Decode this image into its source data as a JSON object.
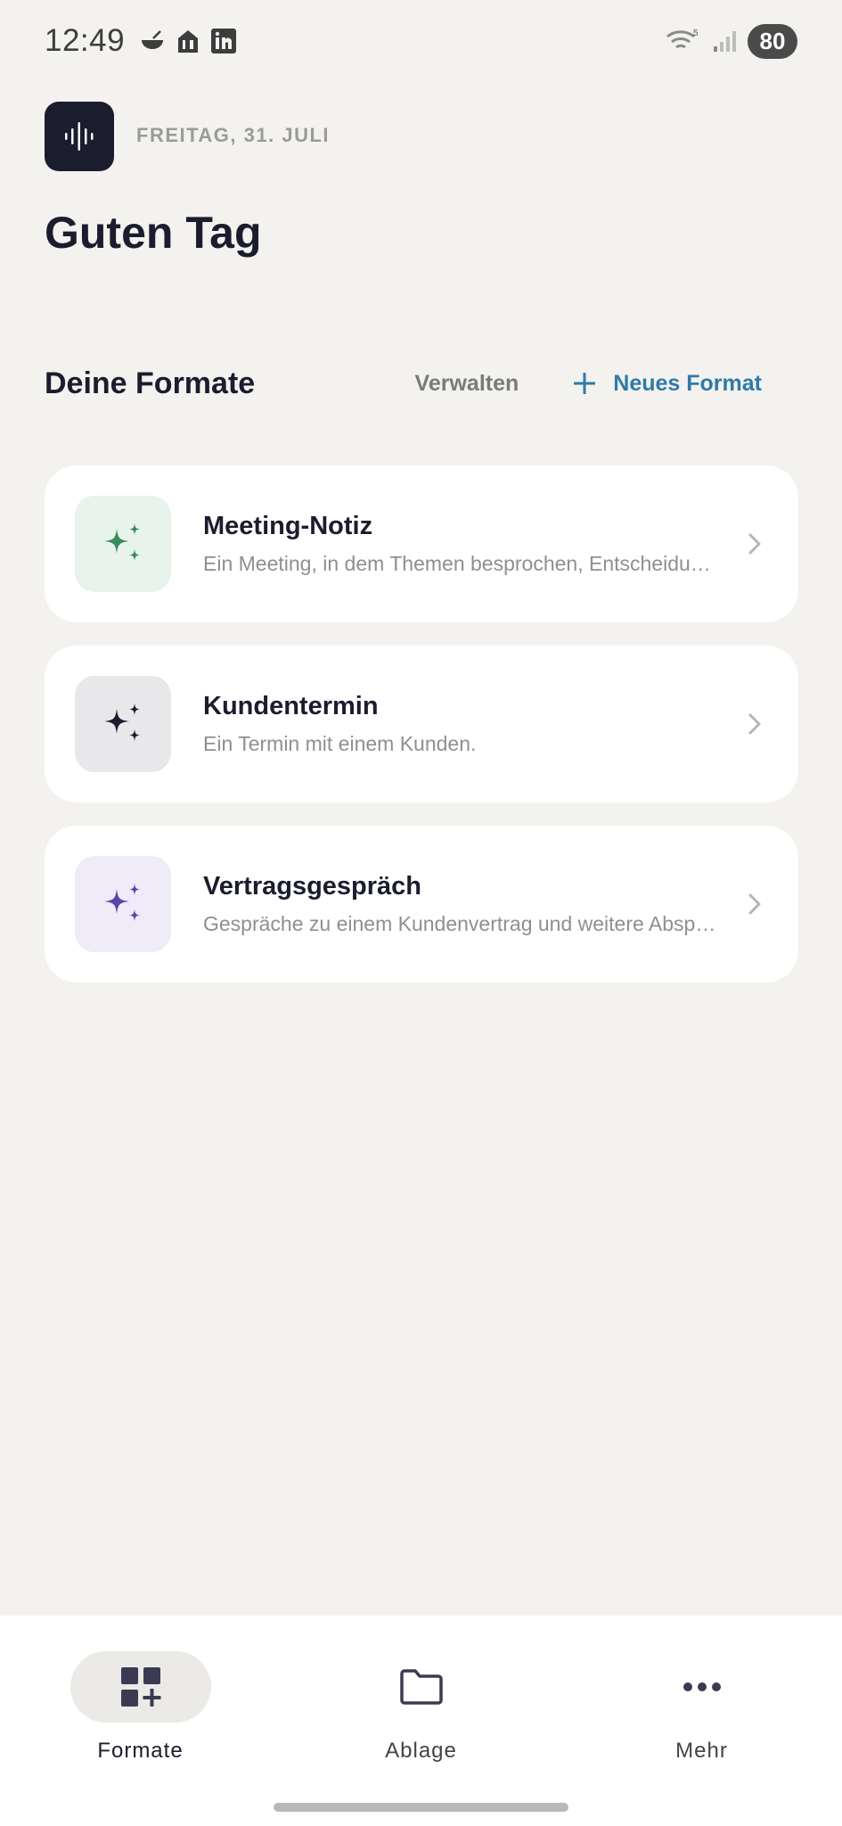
{
  "status_bar": {
    "time": "12:49",
    "battery": "80",
    "left_icons": [
      "bowl-icon",
      "food-delivery-icon",
      "linkedin-icon"
    ],
    "right_icons": [
      "wifi-icon",
      "signal-icon"
    ]
  },
  "header": {
    "date": "FREITAG, 31. JULI",
    "greeting": "Guten Tag",
    "logo_icon": "waveform-icon"
  },
  "formats_section": {
    "title": "Deine Formate",
    "manage_label": "Verwalten",
    "new_format_label": "Neues Format"
  },
  "formats": [
    {
      "title": "Meeting-Notiz",
      "description": "Ein Meeting, in dem Themen besprochen, Entscheidungen getroffen werden",
      "icon": "sparkles-icon",
      "icon_color": "#3a8a5c",
      "icon_bg": "#e8f3ec"
    },
    {
      "title": "Kundentermin",
      "description": "Ein Termin mit einem Kunden.",
      "icon": "sparkles-icon",
      "icon_color": "#1b1c2e",
      "icon_bg": "#e8e8ea"
    },
    {
      "title": "Vertragsgespräch",
      "description": "Gespräche zu einem Kundenvertrag und weitere Absprachen",
      "icon": "sparkles-icon",
      "icon_color": "#5b45a8",
      "icon_bg": "#efebf8"
    }
  ],
  "bottom_nav": {
    "items": [
      {
        "label": "Formate",
        "icon": "grid-add-icon",
        "active": true
      },
      {
        "label": "Ablage",
        "icon": "folder-icon",
        "active": false
      },
      {
        "label": "Mehr",
        "icon": "more-dots-icon",
        "active": false
      }
    ]
  },
  "colors": {
    "accent": "#2f7aa8",
    "dark": "#1b1c2e",
    "background": "#f3f2ef"
  }
}
